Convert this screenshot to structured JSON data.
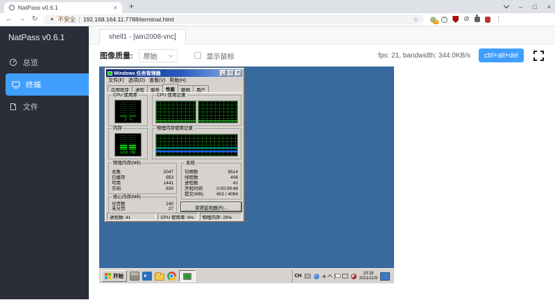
{
  "browser": {
    "tab": {
      "title": "NatPass v0.6.1"
    },
    "icons": {
      "tab_close": "×",
      "new_tab": "+",
      "back": "←",
      "forward": "→",
      "reload": "↻",
      "star": "☆",
      "security_triangle": "▲",
      "blocked": "⊘",
      "menu_dots": "⋮",
      "info": "i"
    },
    "window_controls": {
      "minimize": "–",
      "maximize": "□",
      "close": "×"
    },
    "urlbar": {
      "security_text": "不安全",
      "url": "192.168.164.11:7788/terminal.html",
      "extension_badge": "2"
    }
  },
  "sidebar": {
    "title": "NatPass v0.6.1",
    "items": [
      {
        "label": "总览"
      },
      {
        "label": "终端"
      },
      {
        "label": "文件"
      }
    ]
  },
  "main": {
    "tab_label": "shell1 - [win2008-vnc]",
    "toolbar": {
      "quality_label": "图像质量:",
      "quality_value": "原始",
      "show_cursor_label": "显示鼠标",
      "stats_text": "fps: 21, bandwidth: 344.0KB/s",
      "cad_button_label": "ctrl+alt+del"
    }
  },
  "vnc": {
    "colors": {
      "desktop": "#38699f",
      "accent": "#409eff",
      "led_green": "#00cc00",
      "history_blue": "#1b5cd6"
    },
    "taskmgr": {
      "title": "Windows 任务管理器",
      "window_buttons": {
        "minimize": "_",
        "maximize": "□",
        "close": "×"
      },
      "menu": [
        "文件(F)",
        "选项(O)",
        "查看(V)",
        "帮助(H)"
      ],
      "tabs": [
        "应用程序",
        "进程",
        "服务",
        "性能",
        "联网",
        "用户"
      ],
      "active_tab": "性能",
      "cpu_gauge": {
        "title": "CPU 使用率",
        "value": "2 %"
      },
      "cpu_history": {
        "title": "CPU 使用记录"
      },
      "mem_gauge": {
        "title": "内存",
        "value": "600 MB"
      },
      "mem_history": {
        "title": "物理内存使用记录"
      },
      "physical_memory": {
        "title": "物理内存(MB)",
        "rows": [
          {
            "label": "总数",
            "value": "2047"
          },
          {
            "label": "已缓存",
            "value": "953"
          },
          {
            "label": "可用",
            "value": "1441"
          },
          {
            "label": "空闲",
            "value": "939"
          }
        ]
      },
      "system": {
        "title": "系统",
        "rows": [
          {
            "label": "句柄数",
            "value": "9514"
          },
          {
            "label": "线程数",
            "value": "406"
          },
          {
            "label": "进程数",
            "value": "41"
          },
          {
            "label": "开机时间",
            "value": "0:00:09:48"
          },
          {
            "label": "提交(MB)",
            "value": "602 / 4094"
          }
        ]
      },
      "kernel_memory": {
        "title": "核心内存(MB)",
        "rows": [
          {
            "label": "分页数",
            "value": "140"
          },
          {
            "label": "未分页",
            "value": "27"
          }
        ]
      },
      "resmon_button": "资源监视器(R)...",
      "statusbar": [
        "进程数: 41",
        "CPU 使用率: 6%",
        "物理内存: 29%"
      ]
    },
    "taskbar": {
      "start_label": "开始",
      "lang_indicator": "CH",
      "clock_time": "10:18",
      "clock_date": "2021/11/9"
    }
  }
}
